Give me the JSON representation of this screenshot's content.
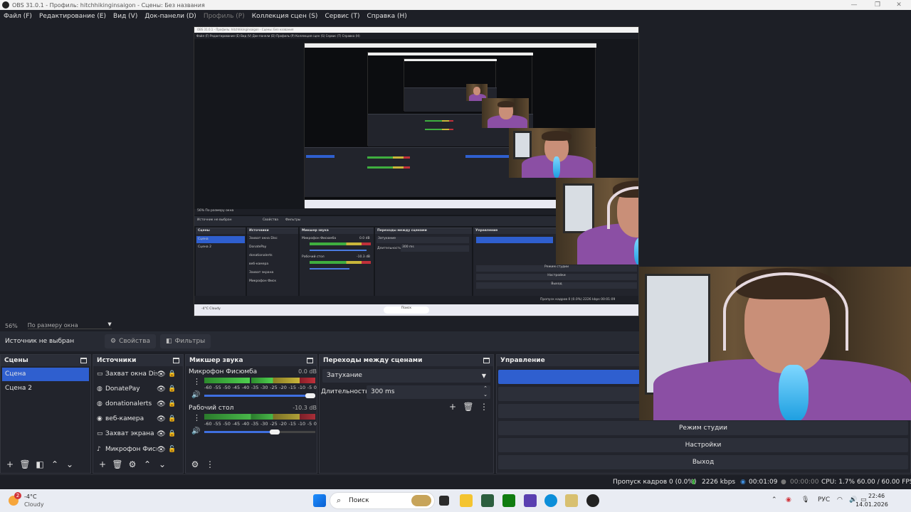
{
  "window": {
    "title": "OBS 31.0.1 - Профиль: hitchhikinginsaigon - Сцены: Без названия",
    "controls": [
      "—",
      "❐",
      "✕"
    ]
  },
  "menu": [
    {
      "label": "Файл (F)",
      "enabled": true
    },
    {
      "label": "Редактирование (E)",
      "enabled": true
    },
    {
      "label": "Вид (V)",
      "enabled": true
    },
    {
      "label": "Док-панели (D)",
      "enabled": true
    },
    {
      "label": "Профиль (P)",
      "enabled": false
    },
    {
      "label": "Коллекция сцен (S)",
      "enabled": true
    },
    {
      "label": "Сервис (T)",
      "enabled": true
    },
    {
      "label": "Справка (H)",
      "enabled": true
    }
  ],
  "preview": {
    "zoom": "56%",
    "scale_mode": "По размеру окна",
    "nested_title": "OBS 31.0.1 - Профиль: hitchhikinginsaigon - Сцены: Без названия",
    "nested_menu": "Файл (F)   Редактирование (E)   Вид (V)   Док-панели (D)   Профиль (P)   Коллекция сцен (S)   Сервис (T)   Справка (H)",
    "nested_zoom": "56%   По размеру окна",
    "nested_source": "Источник не выбран",
    "nested_props": "Свойства",
    "nested_filters": "Фильтры",
    "nested_docks": [
      "Сцены",
      "Источники",
      "Микшер звука",
      "Переходы между сценами",
      "Управление"
    ],
    "nested_scenes": [
      "Сцена",
      "Сцена 2"
    ],
    "nested_sources": [
      "Захват окна Disc",
      "DonatePay",
      "donationalerts",
      "веб-камера",
      "Захват экрана",
      "Микрофон Фиск"
    ],
    "nested_mixer": [
      "Микрофон Фисюмба",
      "Рабочий стол"
    ],
    "nested_mixer_db": [
      "0.0 dB",
      "-10.3 dB"
    ],
    "nested_transition": "Затухание",
    "nested_duration_label": "Длительность",
    "nested_duration": "300 ms",
    "nested_controls": [
      "Режим студии",
      "Настройки",
      "Выход"
    ],
    "nested_status": "Пропуск кадров 0 (0.0%)   2226 kbps   00:01:09",
    "nested_weather": "-4°C Cloudy",
    "nested_search": "Поиск"
  },
  "props_bar": {
    "no_source": "Источник не выбран",
    "properties": "Свойства",
    "filters": "Фильтры"
  },
  "scenes": {
    "title": "Сцены",
    "items": [
      "Сцена",
      "Сцена 2"
    ],
    "selected_index": 0
  },
  "sources": {
    "title": "Источники",
    "items": [
      {
        "icon": "window-capture-icon",
        "glyph": "▭",
        "label": "Захват окна Disc",
        "locked": true
      },
      {
        "icon": "browser-icon",
        "glyph": "◍",
        "label": "DonatePay",
        "locked": true
      },
      {
        "icon": "browser-icon",
        "glyph": "◍",
        "label": "donationalerts",
        "locked": true
      },
      {
        "icon": "camera-icon",
        "glyph": "◉",
        "label": "веб-камера",
        "locked": true
      },
      {
        "icon": "display-capture-icon",
        "glyph": "▭",
        "label": "Захват экрана",
        "locked": true
      },
      {
        "icon": "microphone-icon",
        "glyph": "♪",
        "label": "Микрофон Фиск",
        "locked": false
      }
    ]
  },
  "mixer": {
    "title": "Микшер звука",
    "scale": [
      "-60",
      "-55",
      "-50",
      "-45",
      "-40",
      "-35",
      "-30",
      "-25",
      "-20",
      "-15",
      "-10",
      "-5",
      "0"
    ],
    "channels": [
      {
        "name": "Микрофон Фисюмба",
        "db": "0.0 dB",
        "volume": 1.0
      },
      {
        "name": "Рабочий стол",
        "db": "-10.3 dB",
        "volume": 0.68
      }
    ]
  },
  "transitions": {
    "title": "Переходы между сценами",
    "selected": "Затухание",
    "duration_label": "Длительность",
    "duration": "300 ms"
  },
  "controls": {
    "title": "Управление",
    "buttons": [
      "",
      "",
      "",
      "Режим студии",
      "Настройки",
      "Выход"
    ]
  },
  "status": {
    "dropped": "Пропуск кадров 0 (0.0%)",
    "bitrate": "2226 kbps",
    "stream_time": "00:01:09",
    "record_time": "00:00:00",
    "cpu": "CPU: 1.7%",
    "fps": "60.00 / 60.00 FPS"
  },
  "taskbar": {
    "weather_temp": "-4°C",
    "weather_desc": "Cloudy",
    "notification_count": "2",
    "search_placeholder": "Поиск",
    "lang": "РУС",
    "time": "22:46",
    "date": "14.01.2026"
  },
  "colors": {
    "accent": "#2f5fcf",
    "bg": "#1d1f26",
    "dock": "#22242c"
  }
}
